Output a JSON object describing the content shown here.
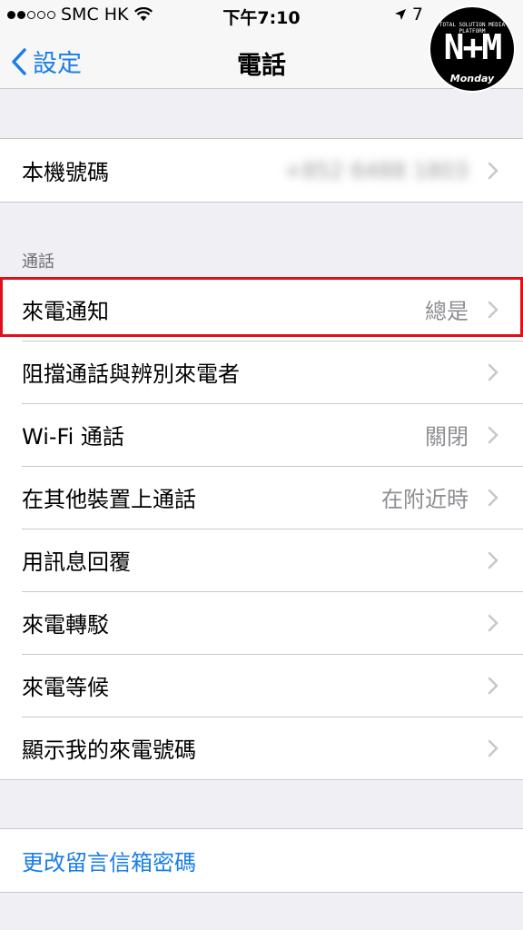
{
  "status_bar": {
    "carrier": "SMC HK",
    "time": "下午7:10",
    "battery_partial": "7"
  },
  "nav": {
    "back_label": "設定",
    "title": "電話"
  },
  "logo": {
    "top_text": "TOTAL SOLUTION MEDIA PLATFORM",
    "main_text": "N+M",
    "bottom_text": "Monday"
  },
  "my_number": {
    "label": "本機號碼",
    "value": "+852 6488 1803"
  },
  "calls_section": {
    "header": "通話",
    "rows": [
      {
        "label": "來電通知",
        "value": "總是"
      },
      {
        "label": "阻擋通話與辨別來電者",
        "value": ""
      },
      {
        "label": "Wi-Fi 通話",
        "value": "關閉"
      },
      {
        "label": "在其他裝置上通話",
        "value": "在附近時"
      },
      {
        "label": "用訊息回覆",
        "value": ""
      },
      {
        "label": "來電轉駁",
        "value": ""
      },
      {
        "label": "來電等候",
        "value": ""
      },
      {
        "label": "顯示我的來電號碼",
        "value": ""
      }
    ]
  },
  "voicemail": {
    "label": "更改留言信箱密碼"
  },
  "colors": {
    "accent": "#1a7ee8",
    "highlight": "#e0101a",
    "background": "#efeff4"
  }
}
